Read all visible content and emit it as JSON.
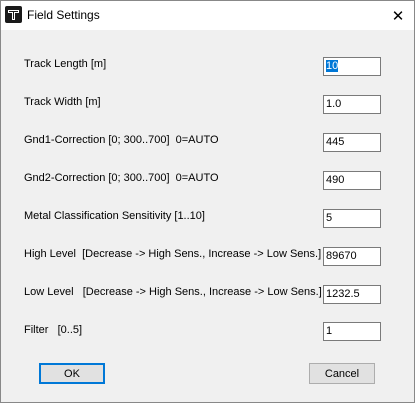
{
  "window": {
    "title": "Field Settings",
    "close_glyph": "✕",
    "icon": "app-logo-icon"
  },
  "fields": [
    {
      "label": "Track Length [m]",
      "value": "10",
      "selected": true
    },
    {
      "label": "Track Width [m]",
      "value": "1.0"
    },
    {
      "label": "Gnd1-Correction [0; 300..700]  0=AUTO",
      "value": "445"
    },
    {
      "label": "Gnd2-Correction [0; 300..700]  0=AUTO",
      "value": "490"
    },
    {
      "label": "Metal Classification Sensitivity [1..10]",
      "value": "5"
    },
    {
      "label": "High Level  [Decrease -> High Sens., Increase -> Low Sens.]",
      "value": "89670"
    },
    {
      "label": "Low Level   [Decrease -> High Sens., Increase -> Low Sens.]",
      "value": "1232.5"
    },
    {
      "label": "Filter   [0..5]",
      "value": "1"
    }
  ],
  "buttons": {
    "ok_label": "OK",
    "cancel_label": "Cancel"
  }
}
